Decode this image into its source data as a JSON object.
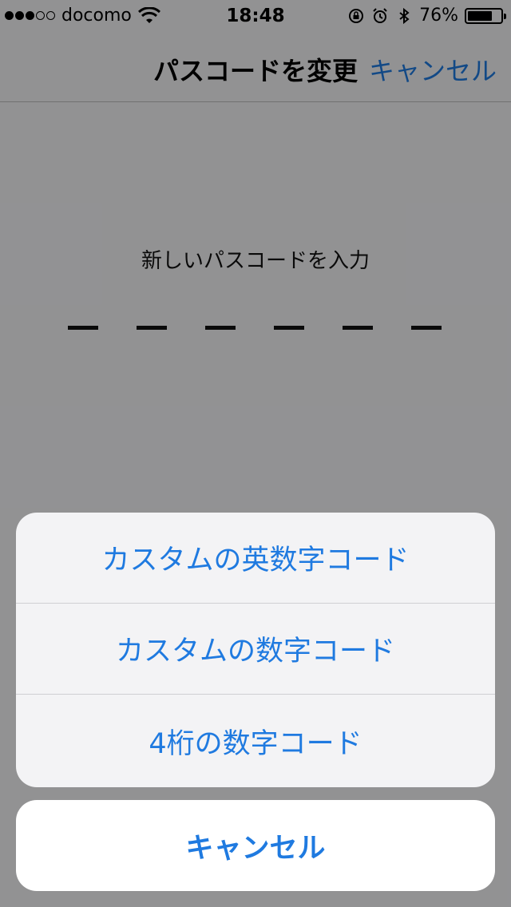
{
  "status_bar": {
    "carrier": "docomo",
    "time": "18:48",
    "battery_percent": "76%",
    "battery_level": 0.76,
    "icons": [
      "wifi-icon",
      "rotation-lock-icon",
      "alarm-icon",
      "bluetooth-icon",
      "battery-icon"
    ]
  },
  "nav": {
    "title": "パスコードを変更",
    "cancel_label": "キャンセル"
  },
  "main": {
    "prompt": "新しいパスコードを入力",
    "digit_count": 6
  },
  "action_sheet": {
    "options": [
      {
        "label": "カスタムの英数字コード"
      },
      {
        "label": "カスタムの数字コード"
      },
      {
        "label": "4桁の数字コード"
      }
    ],
    "cancel_label": "キャンセル"
  },
  "colors": {
    "accent": "#1f7ae0",
    "overlay": "rgba(0,0,0,0.40)"
  }
}
